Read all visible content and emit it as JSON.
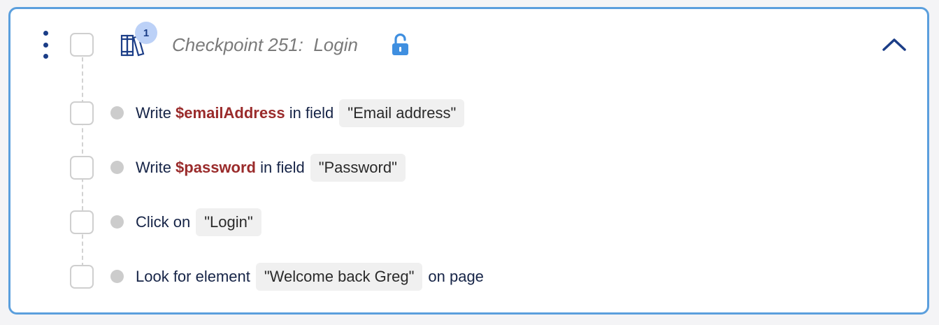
{
  "checkpoint": {
    "badge_count": "1",
    "title": "Checkpoint 251:  Login",
    "icon": "books-icon",
    "lock_icon": "unlocked-padlock-icon",
    "collapse_icon": "chevron-up-icon",
    "menu_icon": "kebab-menu-icon"
  },
  "steps": [
    {
      "pre": "Write ",
      "variable": "$emailAddress",
      "mid": " in field",
      "target": "\"Email address\"",
      "post": ""
    },
    {
      "pre": "Write ",
      "variable": "$password",
      "mid": " in field",
      "target": "\"Password\"",
      "post": ""
    },
    {
      "pre": "Click on",
      "variable": "",
      "mid": "",
      "target": "\"Login\"",
      "post": ""
    },
    {
      "pre": "Look for element",
      "variable": "",
      "mid": "",
      "target": "\"Welcome back Greg\"",
      "post": "on page"
    }
  ],
  "colors": {
    "border": "#5b9fdd",
    "navy": "#1b3d87",
    "variable": "#9a2b2b",
    "lock": "#3f8fe0",
    "badge_bg": "#bcd1f7"
  }
}
